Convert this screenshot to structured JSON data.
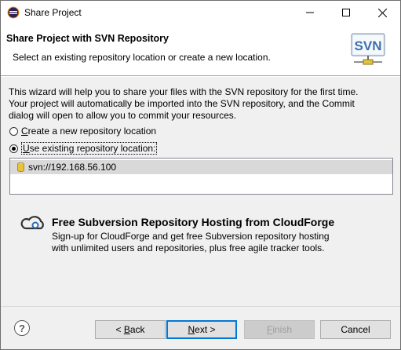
{
  "window": {
    "title": "Share Project"
  },
  "header": {
    "title": "Share Project with SVN Repository",
    "subtitle": "Select an existing repository location or create a new location.",
    "logo_text": "SVN"
  },
  "description": {
    "line1": "This wizard will help you to share your files with the SVN repository for the first time.",
    "line2": "Your project will automatically be imported into the SVN repository, and the Commit",
    "line3": "dialog will open to allow you to commit your resources."
  },
  "options": {
    "create_new": {
      "label": "Create a new repository location",
      "mnemonic": "C",
      "rest": "reate a new repository location",
      "selected": false
    },
    "use_existing": {
      "label": "Use existing repository location:",
      "mnemonic": "U",
      "rest": "se existing repository location:",
      "selected": true
    }
  },
  "repositories": [
    {
      "url": "svn://192.168.56.100",
      "selected": true
    }
  ],
  "cloudforge": {
    "title": "Free Subversion Repository Hosting from CloudForge",
    "line1": "Sign-up for CloudForge and get free Subversion repository hosting",
    "line2": "with unlimited users and repositories, plus free agile tracker tools."
  },
  "buttons": {
    "back_pre": "< ",
    "back_mn": "B",
    "back_rest": "ack",
    "next_mn": "N",
    "next_rest": "ext >",
    "finish_mn": "F",
    "finish_rest": "inish",
    "cancel": "Cancel",
    "help": "?"
  },
  "icons": {
    "app": "eclipse-icon",
    "repo": "repository-icon",
    "cloudforge": "cloudforge-icon"
  },
  "colors": {
    "focus_button_border": "#0078d7",
    "selection_row": "#d9d9d9"
  }
}
